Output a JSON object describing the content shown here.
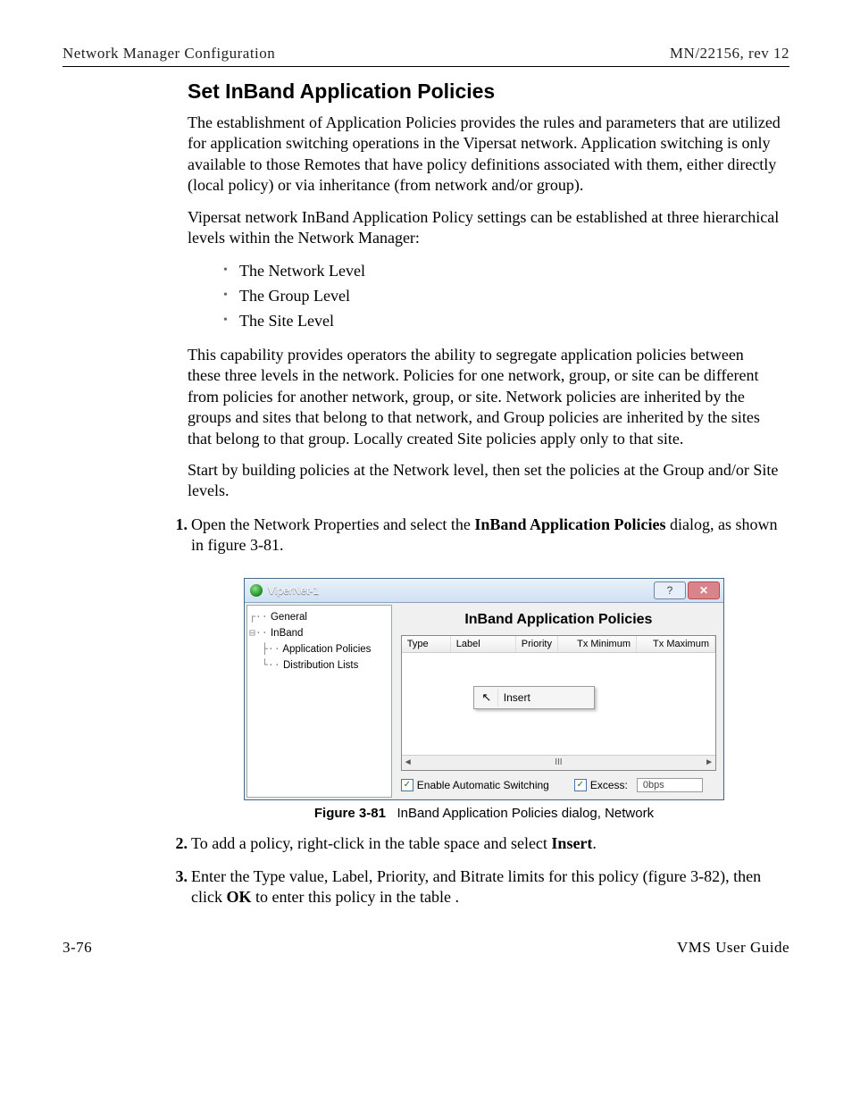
{
  "header": {
    "left": "Network Manager Configuration",
    "right": "MN/22156, rev 12"
  },
  "heading": "Set InBand Application Policies",
  "paragraphs": {
    "p1": "The establishment of Application Policies provides the rules and parameters that are utilized for application switching operations in the Vipersat network. Application switching is only available to those Remotes that have policy definitions associated with them, either directly (local policy) or via inheritance (from network and/or group).",
    "p2": "Vipersat network InBand Application Policy settings can be established at three hierarchical levels within the Network Manager:",
    "p3": "This capability provides operators the ability to segregate application policies between these three levels in the network. Policies for one network, group, or site can be different from policies for another network, group, or site. Network policies are inherited by the groups and sites that belong to that network, and Group policies are inherited by the sites that belong to that group. Locally created Site policies apply only to that site.",
    "p4": "Start by building policies at the Network level, then set the policies at the Group and/or Site levels."
  },
  "bullets": [
    "The Network Level",
    "The Group Level",
    "The Site Level"
  ],
  "steps": {
    "s1_num": "1.",
    "s1_a": "Open the Network Properties and select the ",
    "s1_b": "InBand Application Policies",
    "s1_c": " dialog, as shown in figure 3-81.",
    "s2_num": "2.",
    "s2_a": "To add a policy, right-click in the table space and select ",
    "s2_b": "Insert",
    "s2_c": ".",
    "s3_num": "3.",
    "s3_a": "Enter the Type value, Label, Priority, and Bitrate limits for this policy (figure 3-82), then click ",
    "s3_b": "OK",
    "s3_c": " to enter this policy in the table ."
  },
  "dialog": {
    "title": "ViperNet-1",
    "help_glyph": "?",
    "close_glyph": "✕",
    "tree": {
      "n0": "General",
      "n1": "InBand",
      "n2": "Application Policies",
      "n3": "Distribution Lists"
    },
    "panel_title": "InBand Application Policies",
    "columns": {
      "c0": "Type",
      "c1": "Label",
      "c2": "Priority",
      "c3": "Tx Minimum",
      "c4": "Tx Maximum"
    },
    "context_menu_item": "Insert",
    "scroll_left": "◄",
    "scroll_mid": "III",
    "scroll_right": "►",
    "enable_auto_label": "Enable Automatic Switching",
    "excess_label": "Excess:",
    "excess_value": "0bps",
    "check_glyph": "✓"
  },
  "figure": {
    "label": "Figure 3-81",
    "caption": "InBand Application Policies dialog, Network"
  },
  "footer": {
    "left": "3-76",
    "right": "VMS User Guide"
  }
}
